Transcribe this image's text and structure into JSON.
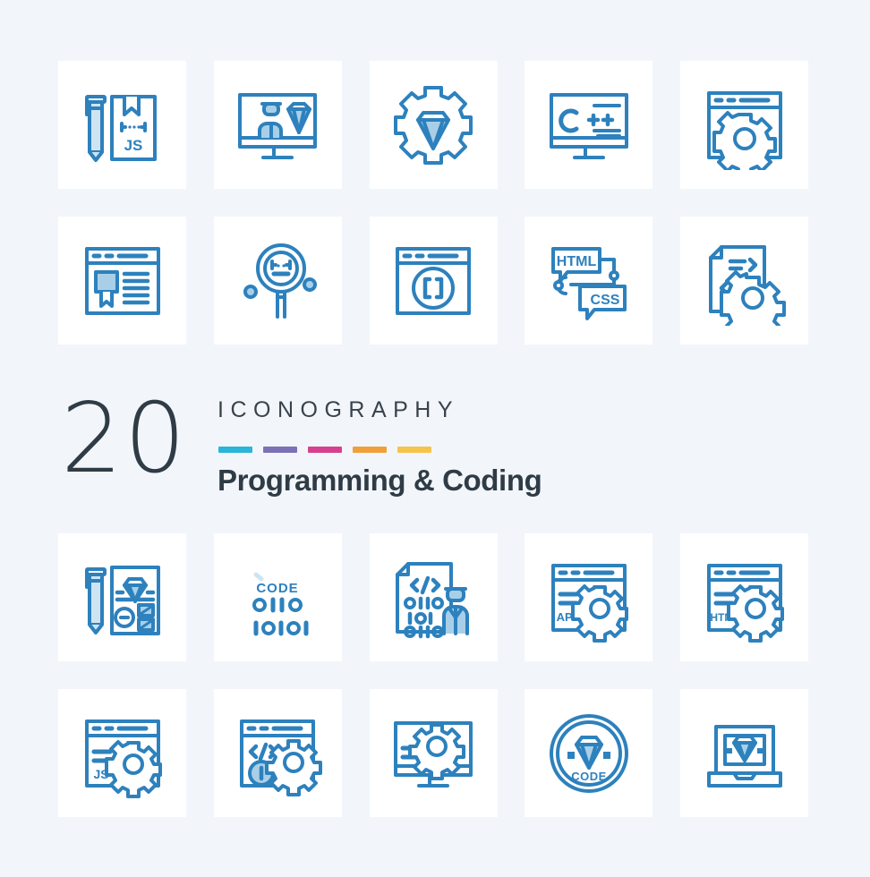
{
  "banner": {
    "count": "20",
    "brand": "ICONOGRAPHY",
    "subtitle": "Programming & Coding",
    "bar_colors": [
      "#29b6d8",
      "#7b72b5",
      "#d6418f",
      "#f0a037",
      "#f6c council"
    ],
    "bars": [
      {
        "name": "bar-cyan",
        "color": "#29b6d8"
      },
      {
        "name": "bar-purple",
        "color": "#7b72b5"
      },
      {
        "name": "bar-magenta",
        "color": "#d6418f"
      },
      {
        "name": "bar-orange",
        "color": "#f0a03a"
      },
      {
        "name": "bar-gold",
        "color": "#f5c councils"
      }
    ]
  },
  "theme": {
    "page_background": "#f2f6fb",
    "tile_background": "#ffffff",
    "icon_stroke": "#2d81bd",
    "icon_fill_light": "#a9cfe8",
    "heading_color": "#2f3b45"
  },
  "icons": [
    {
      "id": 1,
      "name": "pencil-js-book-icon",
      "label": "Pencil and JS book",
      "text": [
        "{...}",
        "JS"
      ]
    },
    {
      "id": 2,
      "name": "monitor-developer-diamond-icon",
      "label": "Monitor with developer and diamond",
      "text": []
    },
    {
      "id": 3,
      "name": "gear-diamond-icon",
      "label": "Gear with diamond",
      "text": []
    },
    {
      "id": 4,
      "name": "monitor-cplusplus-icon",
      "label": "Monitor with C++ code",
      "text": [
        "C++"
      ]
    },
    {
      "id": 5,
      "name": "browser-gear-icon",
      "label": "Browser window with gear",
      "text": []
    },
    {
      "id": 6,
      "name": "browser-certificate-icon",
      "label": "Browser window with certificate",
      "text": []
    },
    {
      "id": 7,
      "name": "magnifier-code-icon",
      "label": "Magnifier with code brackets",
      "text": [
        "{..}"
      ]
    },
    {
      "id": 8,
      "name": "browser-brackets-icon",
      "label": "Browser window with brackets circle",
      "text": [
        "[ ]"
      ]
    },
    {
      "id": 9,
      "name": "html-css-chat-icon",
      "label": "HTML and CSS chat bubbles",
      "text": [
        "HTML",
        "CSS"
      ]
    },
    {
      "id": 10,
      "name": "document-code-gear-icon",
      "label": "Code document with gear",
      "text": []
    },
    {
      "id": 11,
      "name": "pencil-design-document-icon",
      "label": "Pencil and design document",
      "text": []
    },
    {
      "id": 12,
      "name": "code-binary-icon",
      "label": "CODE with binary digits",
      "text": [
        "CODE",
        "0110",
        "10101"
      ]
    },
    {
      "id": 13,
      "name": "code-document-developer-icon",
      "label": "Code document with developer",
      "text": [
        "</>",
        "0110",
        "1010",
        "0110"
      ]
    },
    {
      "id": 14,
      "name": "browser-app-gear-icon",
      "label": "Browser window APP settings",
      "text": [
        "APP"
      ]
    },
    {
      "id": 15,
      "name": "browser-html-gear-icon",
      "label": "Browser window HTML settings",
      "text": [
        "HTML"
      ]
    },
    {
      "id": 16,
      "name": "browser-js-gear-icon",
      "label": "Browser window JS settings",
      "text": [
        "JS"
      ]
    },
    {
      "id": 17,
      "name": "browser-code-info-gear-icon",
      "label": "Browser window code info settings",
      "text": [
        "</>"
      ]
    },
    {
      "id": 18,
      "name": "monitor-gear-icon",
      "label": "Monitor with gear",
      "text": []
    },
    {
      "id": 19,
      "name": "code-diamond-badge-icon",
      "label": "Diamond CODE badge",
      "text": [
        "CODE"
      ]
    },
    {
      "id": 20,
      "name": "laptop-diamond-icon",
      "label": "Laptop with diamond",
      "text": []
    }
  ]
}
